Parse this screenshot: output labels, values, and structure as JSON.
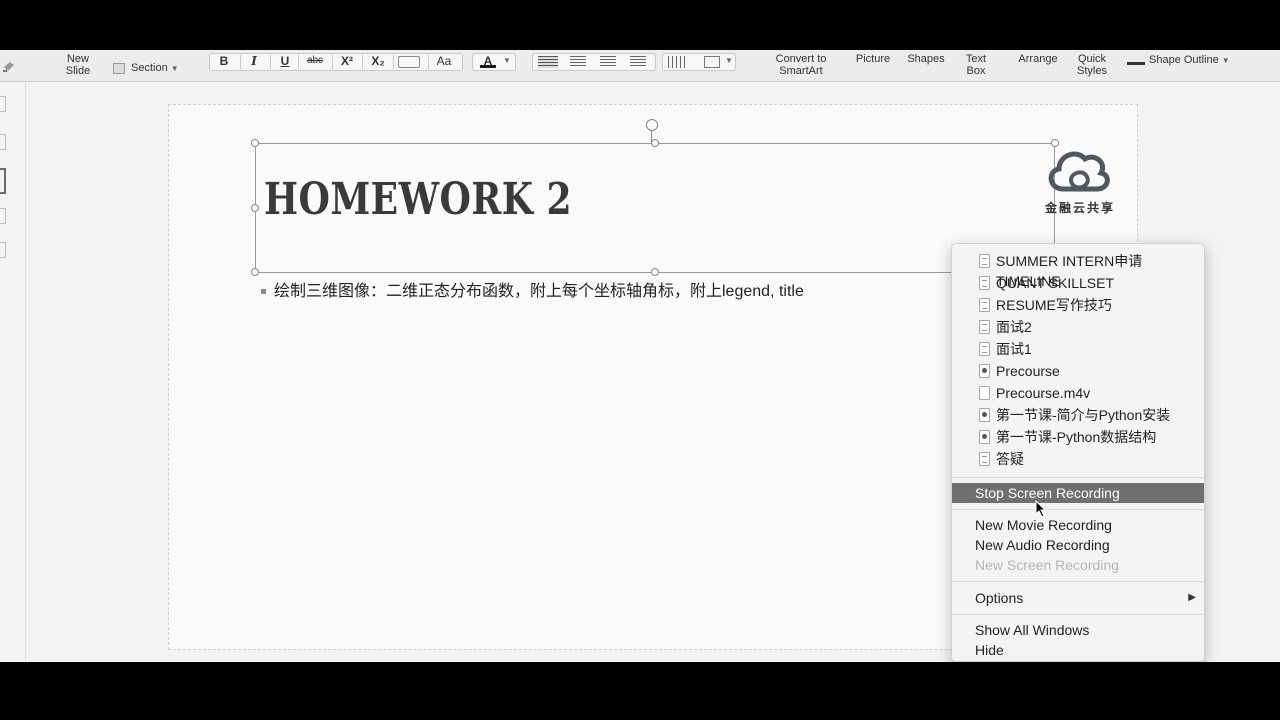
{
  "ribbon": {
    "new_slide": [
      "New",
      "Slide"
    ],
    "section": "Section",
    "bold": "B",
    "italic": "I",
    "underline": "U",
    "strike": "abc",
    "superscript": "X²",
    "subscript": "X₂",
    "case": "Aa",
    "font_color_glyph": "A",
    "convert": [
      "Convert to",
      "SmartArt"
    ],
    "picture": "Picture",
    "shapes": "Shapes",
    "text_box": [
      "Text",
      "Box"
    ],
    "arrange": "Arrange",
    "quick_styles": [
      "Quick",
      "Styles"
    ],
    "shape_outline": "Shape Outline"
  },
  "slide": {
    "title": "HOMEWORK 2",
    "bullet": "绘制三维图像：二维正态分布函数，附上每个坐标轴角标，附上legend, title",
    "logo_text": "金融云共享"
  },
  "menu": {
    "files": [
      {
        "label": "SUMMER INTERN申请TIMELINE",
        "icon": "doc"
      },
      {
        "label": "QUANT SKILLSET",
        "icon": "doc"
      },
      {
        "label": "RESUME写作技巧",
        "icon": "doc"
      },
      {
        "label": "面试2",
        "icon": "doc"
      },
      {
        "label": "面试1",
        "icon": "doc"
      },
      {
        "label": "Precourse",
        "icon": "dot"
      },
      {
        "label": "Precourse.m4v",
        "icon": "blank"
      },
      {
        "label": "第一节课-简介与Python安装",
        "icon": "dot"
      },
      {
        "label": "第一节课-Python数据结构",
        "icon": "dot"
      },
      {
        "label": "答疑",
        "icon": "doc"
      }
    ],
    "stop_screen_recording": "Stop Screen Recording",
    "new_movie_recording": "New Movie Recording",
    "new_audio_recording": "New Audio Recording",
    "new_screen_recording": "New Screen Recording",
    "options": "Options",
    "show_all_windows": "Show All Windows",
    "hide": "Hide"
  },
  "colors": {
    "menu_highlight": "#6f6f6f",
    "disabled_text": "#b5b5b5"
  }
}
